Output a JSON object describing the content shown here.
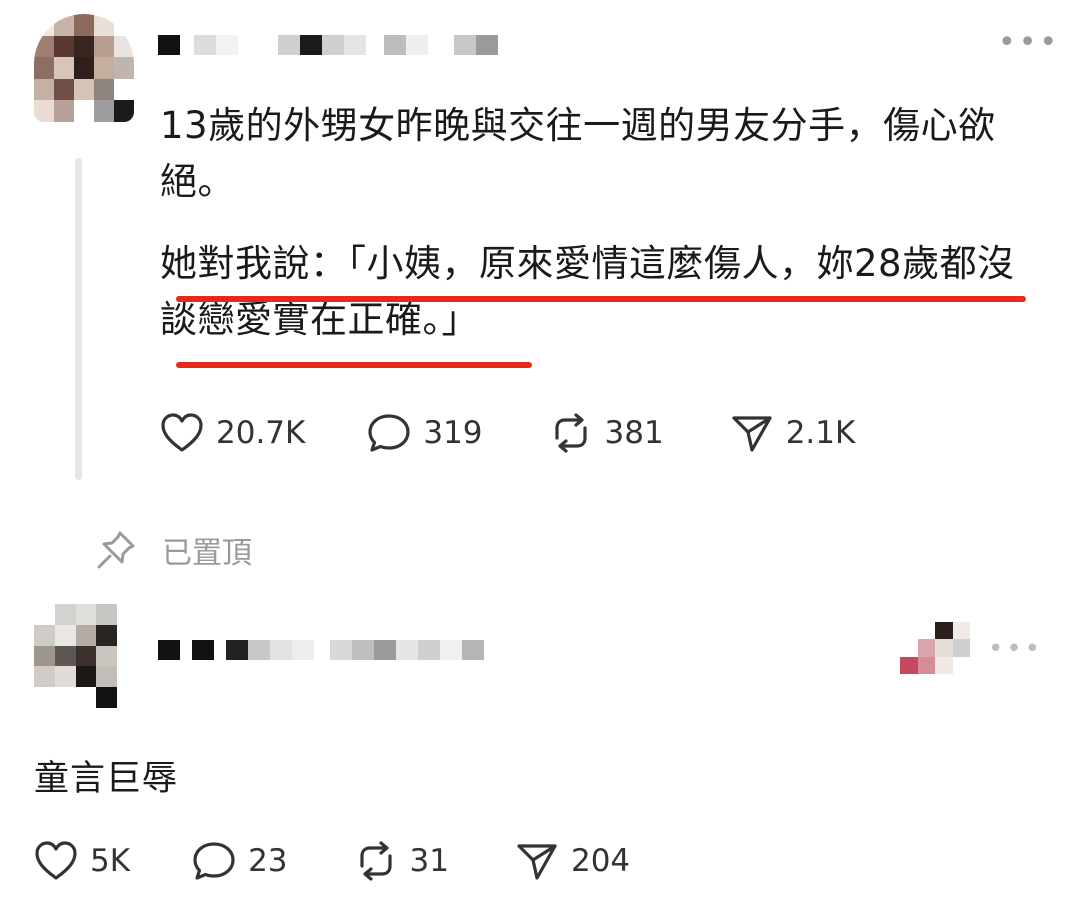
{
  "post": {
    "text_line1": "13歲的外甥女昨晚與交往一週的男友分手，傷心欲絕。",
    "text_line2": "她對我說：「小姨，原來愛情這麼傷人，妳28歲都沒談戀愛實在正確。」",
    "highlight_color": "#e8281a",
    "stats": {
      "likes": "20.7K",
      "comments": "319",
      "reposts": "381",
      "shares": "2.1K"
    },
    "pinned_label": "已置頂"
  },
  "reply": {
    "text": "童言巨辱",
    "stats": {
      "likes": "5K",
      "comments": "23",
      "reposts": "31",
      "shares": "204"
    }
  },
  "icons": {
    "like": "heart-icon",
    "comment": "comment-bubble-icon",
    "repost": "repost-icon",
    "share": "send-icon",
    "pin": "pin-icon",
    "more": "more-dots-icon"
  },
  "more_label": "•••"
}
